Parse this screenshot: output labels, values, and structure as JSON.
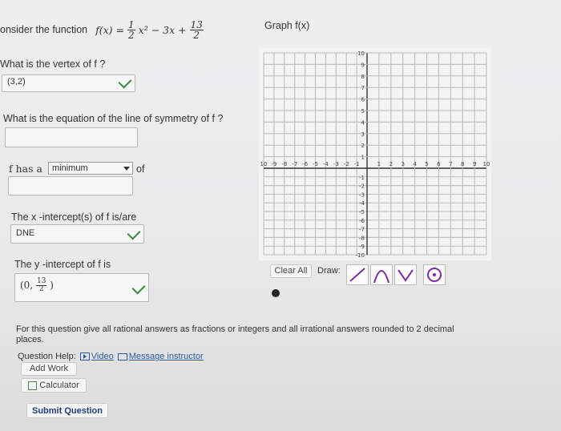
{
  "problem": {
    "prefix": "onsider the function",
    "func": "f(x) =",
    "frac1_num": "1",
    "frac1_den": "2",
    "term1": "x²",
    "mid": "− 3x +",
    "frac2_num": "13",
    "frac2_den": "2"
  },
  "graph_title": "Graph f(x)",
  "vertex": {
    "question": "What is the vertex of f ?",
    "answer": "(3,2)"
  },
  "symmetry": {
    "question": "What is the equation of the line of symmetry of f ?",
    "answer": ""
  },
  "minmax": {
    "label_pre": "f has a",
    "selected": "minimum",
    "label_post": "of",
    "answer": ""
  },
  "x_intercepts": {
    "question": "The x -intercept(s) of f is/are",
    "answer": "DNE"
  },
  "y_intercept": {
    "question": "The y -intercept of f is",
    "answer_prefix": "(0,",
    "num": "13",
    "den": "2",
    "answer_suffix": ")"
  },
  "graph": {
    "x_ticks": [
      "10",
      "-9",
      "-8",
      "-7",
      "-6",
      "-5",
      "-4",
      "-3",
      "-2",
      "-1",
      "1",
      "2",
      "3",
      "4",
      "5",
      "6",
      "7",
      "8",
      "9",
      "10"
    ],
    "y_ticks": [
      "10",
      "9",
      "8",
      "7",
      "6",
      "5",
      "4",
      "3",
      "2",
      "1",
      "-1",
      "-2",
      "-3",
      "-4",
      "-5",
      "-6",
      "-7",
      "-8",
      "-9",
      "-10"
    ]
  },
  "tools": {
    "clear_all": "Clear All",
    "draw": "Draw:"
  },
  "instructions": "For this question give all rational answers as fractions or integers and all irrational answers rounded to 2 decimal places.",
  "help": {
    "label": "Question Help:",
    "video": "Video",
    "message": "Message instructor"
  },
  "buttons": {
    "add_work": "Add Work",
    "calculator": "Calculator",
    "submit": "Submit Question"
  }
}
